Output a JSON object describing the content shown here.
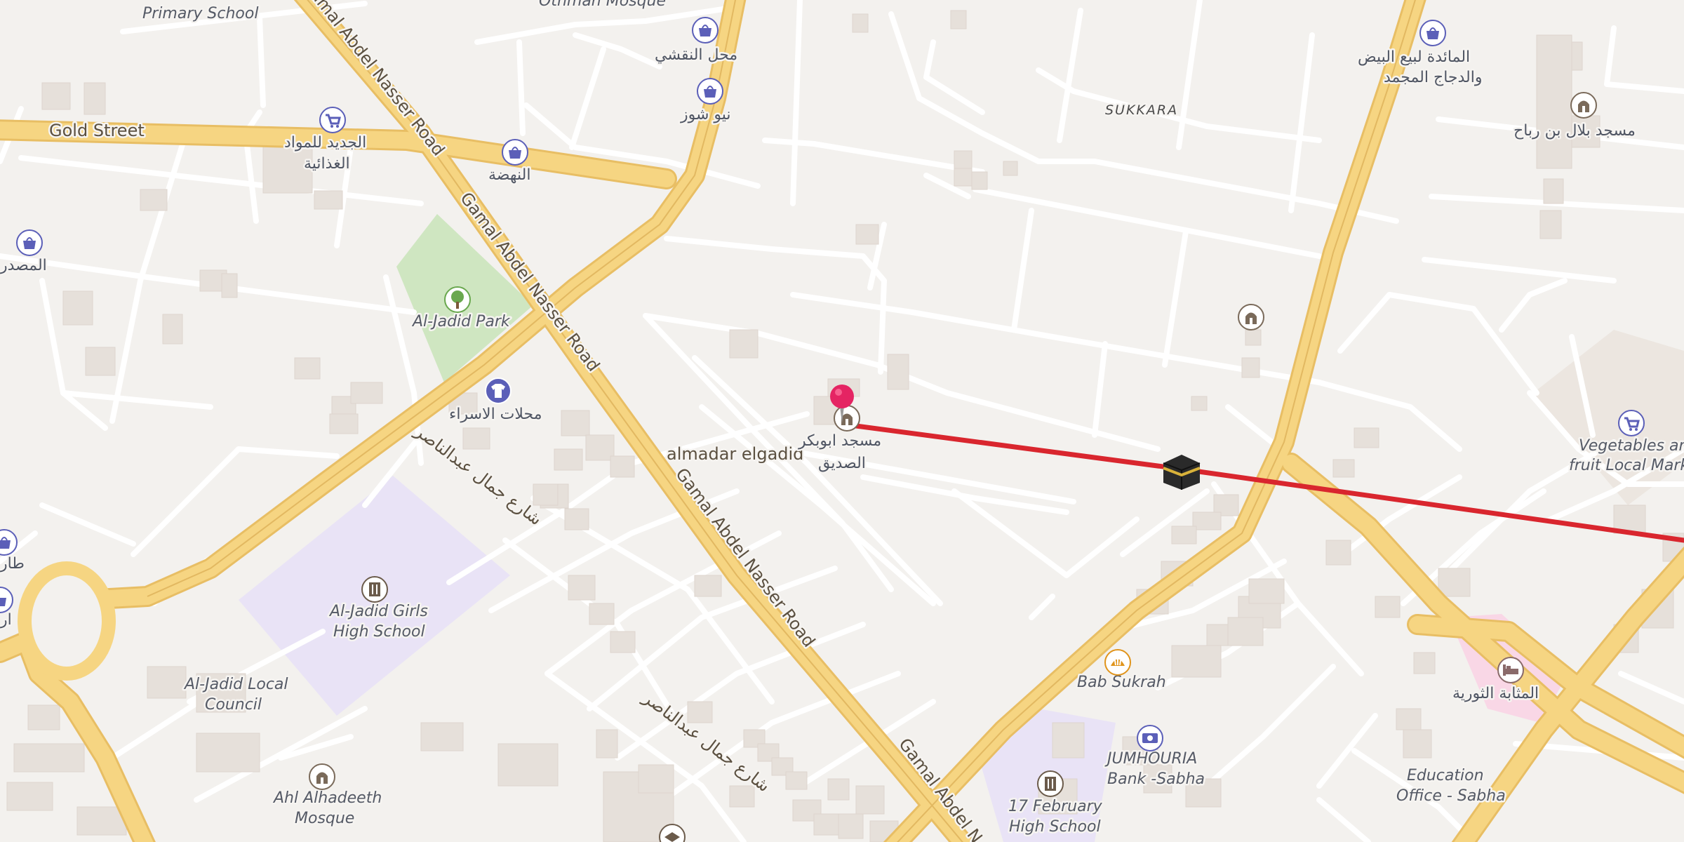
{
  "map": {
    "district": "SUKKARA",
    "roads": {
      "gold_street": "Gold Street",
      "gamal_1": "Gamal Abdel Nasser Road",
      "gamal_2": "Gamal Abdel Nasser Road",
      "gamal_3": "Gamal Abdel Nasser Road",
      "gamal_4": "Gamal Abdel N",
      "almadar": "almadar elgadid",
      "arabic_1": "شارع جمال عبدالناصر",
      "arabic_2": "شارع جمال عبدالناصر"
    },
    "pois": {
      "primary_school": "Primary School",
      "othman_mosque": "Othman Mosque",
      "mahal_naqshi": "محل النقشي",
      "new_shoes": "نيو شوز",
      "jadeed_food_1": "الجديد للمواد",
      "jadeed_food_2": "الغذائية",
      "nahda": "النهضة",
      "masdar": "المصدر",
      "jadid_park": "Al-Jadid Park",
      "asraa_shops": "محلات الاسراء",
      "girls_school_1": "Al-Jadid Girls",
      "girls_school_2": "High School",
      "local_council_1": "Al-Jadid Local",
      "local_council_2": "Council",
      "ahl_mosque_1": "Ahl Alhadeeth",
      "ahl_mosque_2": "Mosque",
      "abubakr_1": "مسجد ابوبكر",
      "abubakr_2": "الصديق",
      "bab_sukrah": "Bab Sukrah",
      "bank_1": "JUMHOURIA",
      "bank_2": "Bank -Sabha",
      "feb17_1": "17 February",
      "feb17_2": "High School",
      "maida_1": "المائدة لبيع البيض",
      "maida_2": "والدجاج المجمد",
      "bilal_mosque": "مسجد بلال بن رباح",
      "vegetables_1": "Vegetables and",
      "vegetables_2": "fruit Local Mark",
      "mathaba": "المثابة الثورية",
      "education_1": "Education",
      "education_2": "Office - Sabha",
      "left_cut_1": "طار",
      "left_cut_2": "ار"
    },
    "colors": {
      "background": "#f3f1ee",
      "road_major": "#f6d582",
      "road_major_casing": "#e8be64",
      "road_minor": "#ffffff",
      "building": "#e6e0da",
      "park": "#cfe6c1",
      "school_area": "#e9e3f6",
      "hospital_area": "#f9d7e6",
      "route_line": "#d9262e",
      "pin": "#e52463",
      "poi_icon": "#5b5fb8"
    },
    "icons": [
      "shopping-bag-icon",
      "shopping-cart-icon",
      "tshirt-icon",
      "tree-icon",
      "school-icon",
      "mosque-icon",
      "kaaba-icon",
      "bakery-icon",
      "bank-icon",
      "bed-icon",
      "education-icon",
      "location-pin-icon"
    ]
  }
}
